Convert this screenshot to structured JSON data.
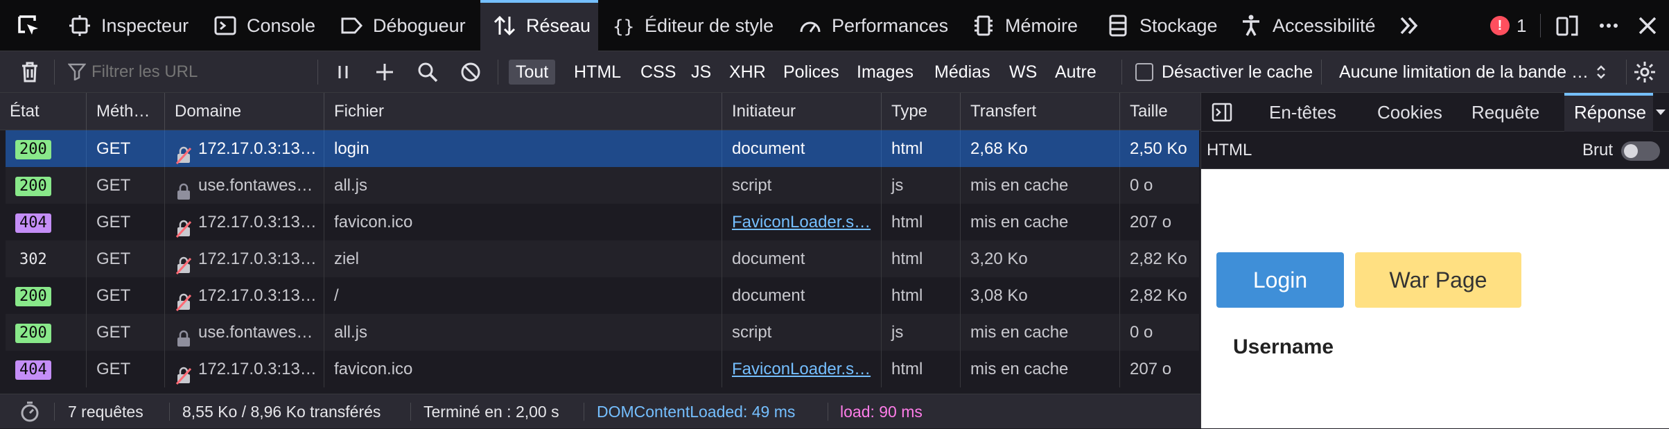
{
  "toolbar": {
    "tabs": [
      {
        "label": "Inspecteur",
        "icon": "inspector-icon"
      },
      {
        "label": "Console",
        "icon": "console-icon"
      },
      {
        "label": "Débogueur",
        "icon": "debugger-icon"
      },
      {
        "label": "Réseau",
        "icon": "network-icon",
        "selected": true
      },
      {
        "label": "Éditeur de style",
        "icon": "style-editor-icon"
      },
      {
        "label": "Performances",
        "icon": "performance-icon"
      },
      {
        "label": "Mémoire",
        "icon": "memory-icon"
      },
      {
        "label": "Stockage",
        "icon": "storage-icon"
      },
      {
        "label": "Accessibilité",
        "icon": "accessibility-icon"
      }
    ],
    "error_count": "1"
  },
  "filterbar": {
    "search_placeholder": "Filtrer les URL",
    "types": [
      "Tout",
      "HTML",
      "CSS",
      "JS",
      "XHR",
      "Polices",
      "Images",
      "Médias",
      "WS",
      "Autre"
    ],
    "selected_type": "Tout",
    "disable_cache_label": "Désactiver le cache",
    "throttling_label": "Aucune limitation de la bande …"
  },
  "table": {
    "columns": [
      "État",
      "Méth…",
      "Domaine",
      "Fichier",
      "Initiateur",
      "Type",
      "Transfert",
      "Taille"
    ],
    "rows": [
      {
        "status": "200",
        "method": "GET",
        "domain": "172.17.0.3:13…",
        "domain_icon": "insecure",
        "file": "login",
        "initiator": "document",
        "initiator_link": false,
        "type": "html",
        "transfer": "2,68 Ko",
        "size": "2,50 Ko",
        "selected": true
      },
      {
        "status": "200",
        "method": "GET",
        "domain": "use.fontawes…",
        "domain_icon": "lock",
        "file": "all.js",
        "initiator": "script",
        "initiator_link": false,
        "type": "js",
        "transfer": "mis en cache",
        "size": "0 o"
      },
      {
        "status": "404",
        "method": "GET",
        "domain": "172.17.0.3:13…",
        "domain_icon": "insecure",
        "file": "favicon.ico",
        "initiator": "FaviconLoader.s…",
        "initiator_link": true,
        "type": "html",
        "transfer": "mis en cache",
        "size": "207 o"
      },
      {
        "status": "302",
        "method": "GET",
        "domain": "172.17.0.3:13…",
        "domain_icon": "insecure",
        "file": "ziel",
        "initiator": "document",
        "initiator_link": false,
        "type": "html",
        "transfer": "3,20 Ko",
        "size": "2,82 Ko"
      },
      {
        "status": "200",
        "method": "GET",
        "domain": "172.17.0.3:13…",
        "domain_icon": "insecure",
        "file": "/",
        "initiator": "document",
        "initiator_link": false,
        "type": "html",
        "transfer": "3,08 Ko",
        "size": "2,82 Ko"
      },
      {
        "status": "200",
        "method": "GET",
        "domain": "use.fontawes…",
        "domain_icon": "lock",
        "file": "all.js",
        "initiator": "script",
        "initiator_link": false,
        "type": "js",
        "transfer": "mis en cache",
        "size": "0 o"
      },
      {
        "status": "404",
        "method": "GET",
        "domain": "172.17.0.3:13…",
        "domain_icon": "insecure",
        "file": "favicon.ico",
        "initiator": "FaviconLoader.s…",
        "initiator_link": true,
        "type": "html",
        "transfer": "mis en cache",
        "size": "207 o"
      }
    ]
  },
  "statusbar": {
    "requests": "7 requêtes",
    "transferred": "8,55 Ko / 8,96 Ko transférés",
    "finished": "Terminé en : 2,00 s",
    "domcontentloaded": "DOMContentLoaded: 49 ms",
    "load": "load: 90 ms",
    "domcontentloaded_color": "#75bfff",
    "load_color": "#ff7de9"
  },
  "sidepanel": {
    "tabs": [
      "En-têtes",
      "Cookies",
      "Requête",
      "Réponse"
    ],
    "selected_tab": "Réponse",
    "format_label": "HTML",
    "raw_label": "Brut",
    "preview": {
      "login_button": "Login",
      "war_page_button": "War Page",
      "username_label": "Username",
      "login_color": "#3f8fd8",
      "war_color": "#ffe082"
    }
  }
}
